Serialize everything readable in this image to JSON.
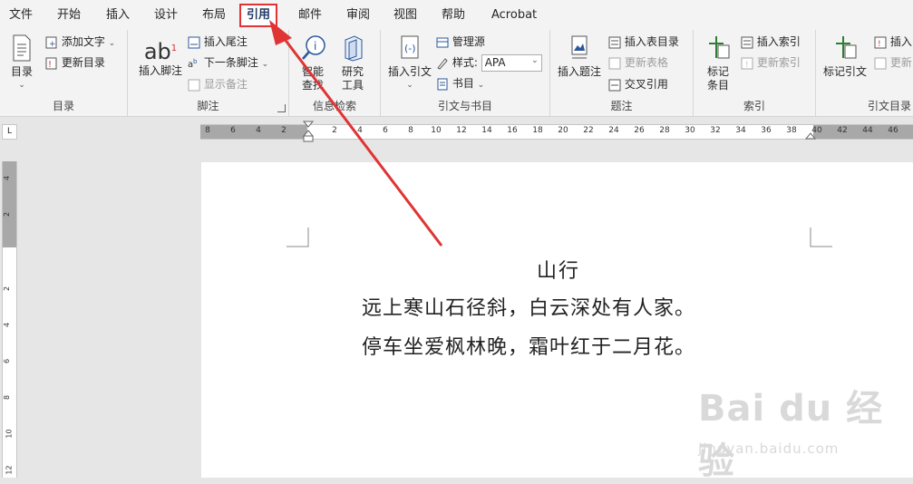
{
  "tabs": [
    "文件",
    "开始",
    "插入",
    "设计",
    "布局",
    "引用",
    "邮件",
    "审阅",
    "视图",
    "帮助",
    "Acrobat"
  ],
  "active_tab": "引用",
  "groups": {
    "toc": {
      "label": "目录",
      "toc_button": "目录",
      "add_text": "添加文字",
      "update_toc": "更新目录"
    },
    "footnotes": {
      "label": "脚注",
      "insert_footnote": "插入脚注",
      "insert_footnote_glyph": "ab",
      "insert_footnote_sup": "1",
      "insert_endnote": "插入尾注",
      "next_footnote": "下一条脚注",
      "show_notes": "显示备注"
    },
    "research": {
      "label": "信息检索",
      "smart_lookup": "智能\n查找",
      "researcher": "研究\n工具"
    },
    "citations": {
      "label": "引文与书目",
      "insert_citation": "插入引文",
      "manage_sources": "管理源",
      "style_label": "样式:",
      "style_value": "APA",
      "bibliography": "书目"
    },
    "captions": {
      "label": "题注",
      "insert_caption": "插入题注",
      "insert_table_of_figures": "插入表目录",
      "update_table": "更新表格",
      "cross_reference": "交叉引用"
    },
    "index": {
      "label": "索引",
      "mark_entry": "标记\n条目",
      "insert_index": "插入索引",
      "update_index": "更新索引"
    },
    "authorities": {
      "label": "引文目录",
      "mark_citation": "标记引文",
      "insert_toa": "插入",
      "update_toa": "更新"
    }
  },
  "ruler": {
    "h_ticks": [
      "8",
      "6",
      "4",
      "2",
      "2",
      "4",
      "6",
      "8",
      "10",
      "12",
      "14",
      "16",
      "18",
      "20",
      "22",
      "24",
      "26",
      "28",
      "30",
      "32",
      "34",
      "36",
      "38",
      "40",
      "42",
      "44",
      "46"
    ],
    "v_ticks": [
      "4",
      "2",
      "2",
      "4",
      "6",
      "8",
      "10",
      "12"
    ]
  },
  "document": {
    "title": "山行",
    "lines": [
      "远上寒山石径斜，白云深处有人家。",
      "停车坐爱枫林晚，霜叶红于二月花。"
    ]
  },
  "watermark": {
    "main": "Bai du 经验",
    "sub": "jingyan.baidu.com"
  },
  "colors": {
    "highlight": "#e03434",
    "arrow": "#e03434",
    "ribbon_bg": "#f3f3f3",
    "accent_blue": "#2b579a"
  }
}
